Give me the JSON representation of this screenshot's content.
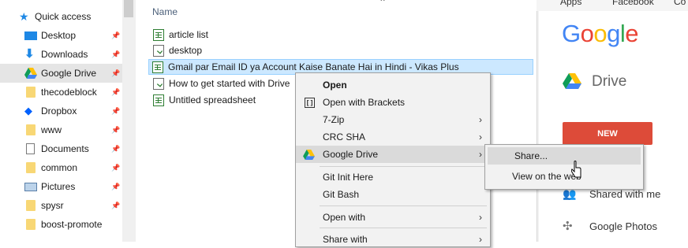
{
  "nav": {
    "items": [
      {
        "label": "Quick access",
        "icon": "star-icon"
      },
      {
        "label": "Desktop",
        "icon": "desktop-icon"
      },
      {
        "label": "Downloads",
        "icon": "download-icon"
      },
      {
        "label": "Google Drive",
        "icon": "google-drive-icon"
      },
      {
        "label": "thecodeblock",
        "icon": "folder-icon"
      },
      {
        "label": "Dropbox",
        "icon": "dropbox-icon"
      },
      {
        "label": "www",
        "icon": "folder-icon"
      },
      {
        "label": "Documents",
        "icon": "documents-icon"
      },
      {
        "label": "common",
        "icon": "folder-icon"
      },
      {
        "label": "Pictures",
        "icon": "pictures-icon"
      },
      {
        "label": "spysr",
        "icon": "folder-icon"
      },
      {
        "label": "boost-promote",
        "icon": "folder-icon"
      }
    ]
  },
  "filelist": {
    "column_name": "Name",
    "files": [
      {
        "name": "article list",
        "icon": "spreadsheet-icon"
      },
      {
        "name": "desktop",
        "icon": "document-icon"
      },
      {
        "name": "Gmail par Email ID ya Account Kaise Banate Hai in Hindi - Vikas Plus",
        "icon": "spreadsheet-icon"
      },
      {
        "name": "How to get started with Drive",
        "icon": "document-icon"
      },
      {
        "name": "Untitled spreadsheet",
        "icon": "spreadsheet-icon"
      }
    ]
  },
  "context_menu": {
    "open": "Open",
    "open_with_brackets": "Open with Brackets",
    "seven_zip": "7-Zip",
    "crc_sha": "CRC SHA",
    "google_drive": "Google Drive",
    "git_init": "Git Init Here",
    "git_bash": "Git Bash",
    "open_with": "Open with",
    "share_with": "Share with"
  },
  "submenu": {
    "share": "Share...",
    "view_on_web": "View on the web"
  },
  "chrome": {
    "bookmarks": [
      "Apps",
      "Facebook",
      "Co"
    ],
    "logo": "Google",
    "drive_title": "Drive",
    "new_button": "NEW",
    "shared_with_me": "Shared with me",
    "google_photos": "Google Photos"
  },
  "colors": {
    "selection": "#cce8ff",
    "new_button": "#dd4b39",
    "menu_bg": "#f2f2f2"
  }
}
